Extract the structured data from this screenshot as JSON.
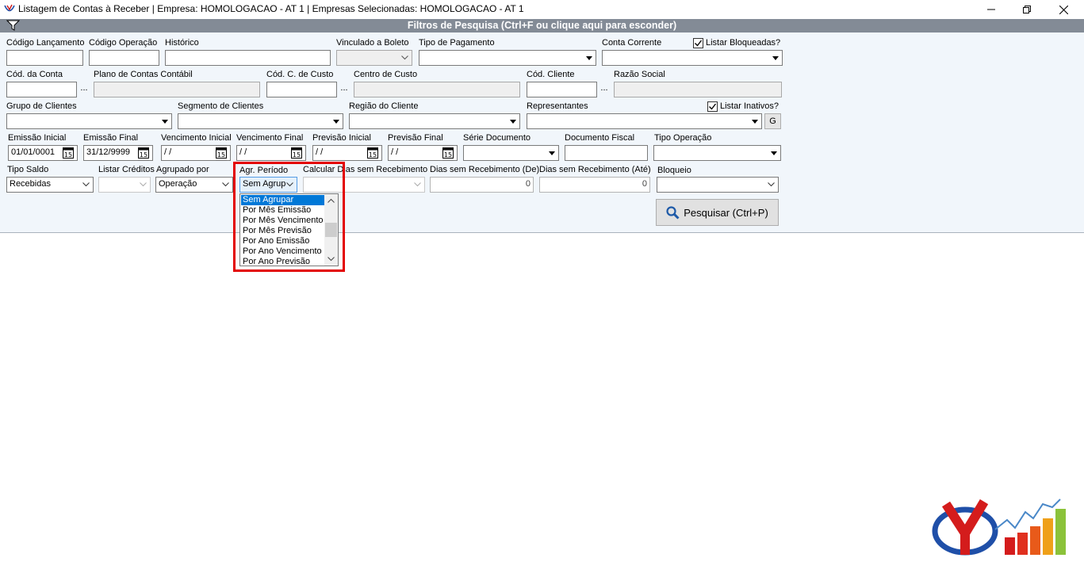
{
  "window": {
    "title": "Listagem de Contas à Receber | Empresa: HOMOLOGACAO - AT 1 | Empresas Selecionadas: HOMOLOGACAO - AT 1",
    "icon": "app-logo-icon",
    "controls": [
      "minimize-icon",
      "restore-icon",
      "close-icon"
    ]
  },
  "filter_header": {
    "title": "Filtros de Pesquisa (Ctrl+F ou clique aqui para esconder)",
    "icon": "funnel-icon"
  },
  "row1": {
    "codigo_lancamento": "Código Lançamento",
    "codigo_operacao": "Código Operação",
    "historico": "Histórico",
    "vinculado_boleto": "Vinculado a Boleto",
    "tipo_pagamento": "Tipo de Pagamento",
    "conta_corrente": "Conta Corrente",
    "listar_bloqueadas": "Listar Bloqueadas?"
  },
  "row2": {
    "cod_conta": "Cód. da Conta",
    "plano_contas": "Plano de Contas Contábil",
    "cod_c_custo": "Cód. C. de Custo",
    "centro_custo": "Centro de Custo",
    "cod_cliente": "Cód. Cliente",
    "razao_social": "Razão Social",
    "ellipsis": "..."
  },
  "row3": {
    "grupo_clientes": "Grupo de Clientes",
    "segmento_clientes": "Segmento de Clientes",
    "regiao_cliente": "Região do Cliente",
    "representantes": "Representantes",
    "listar_inativos": "Listar Inativos?",
    "g_button": "G"
  },
  "row4": {
    "emissao_inicial": "Emissão Inicial",
    "emissao_inicial_value": "01/01/0001",
    "emissao_final": "Emissão Final",
    "emissao_final_value": "31/12/9999",
    "vencimento_inicial": "Vencimento Inicial",
    "vencimento_inicial_value": " / /",
    "vencimento_final": "Vencimento Final",
    "vencimento_final_value": " / /",
    "previsao_inicial": "Previsão Inicial",
    "previsao_inicial_value": " / /",
    "previsao_final": "Previsão Final",
    "previsao_final_value": " / /",
    "serie_documento": "Série Documento",
    "documento_fiscal": "Documento Fiscal",
    "tipo_operacao": "Tipo Operação",
    "calendar_glyph": "15"
  },
  "row5": {
    "tipo_saldo": "Tipo Saldo",
    "tipo_saldo_value": "Recebidas",
    "listar_creditos": "Listar Créditos",
    "agrupado_por": "Agrupado por",
    "agrupado_por_value": "Operação",
    "agr_periodo": "Agr. Período",
    "agr_periodo_value": "Sem Agrup",
    "calcular_dias": "Calcular Dias sem Recebimento",
    "dias_de": "Dias sem Recebimento (De)",
    "dias_de_value": "0",
    "dias_ate": "Dias sem Recebimento (Até)",
    "dias_ate_value": "0",
    "bloqueio": "Bloqueio"
  },
  "agr_periodo_options": [
    "Sem Agrupar",
    "Por Mês Emissão",
    "Por Mês Vencimento",
    "Por Mês Previsão",
    "Por Ano Emissão",
    "Por Ano Vencimento",
    "Por Ano Previsão"
  ],
  "agr_periodo_selected_index": 0,
  "search_button": {
    "label": "Pesquisar (Ctrl+P)",
    "icon": "magnifier-icon"
  },
  "colors": {
    "header_bg": "#838b96",
    "panel_bg": "#f1f6fb",
    "selection": "#0078d7",
    "highlight_border": "#e30000"
  },
  "logo": "brand-logo-icon"
}
